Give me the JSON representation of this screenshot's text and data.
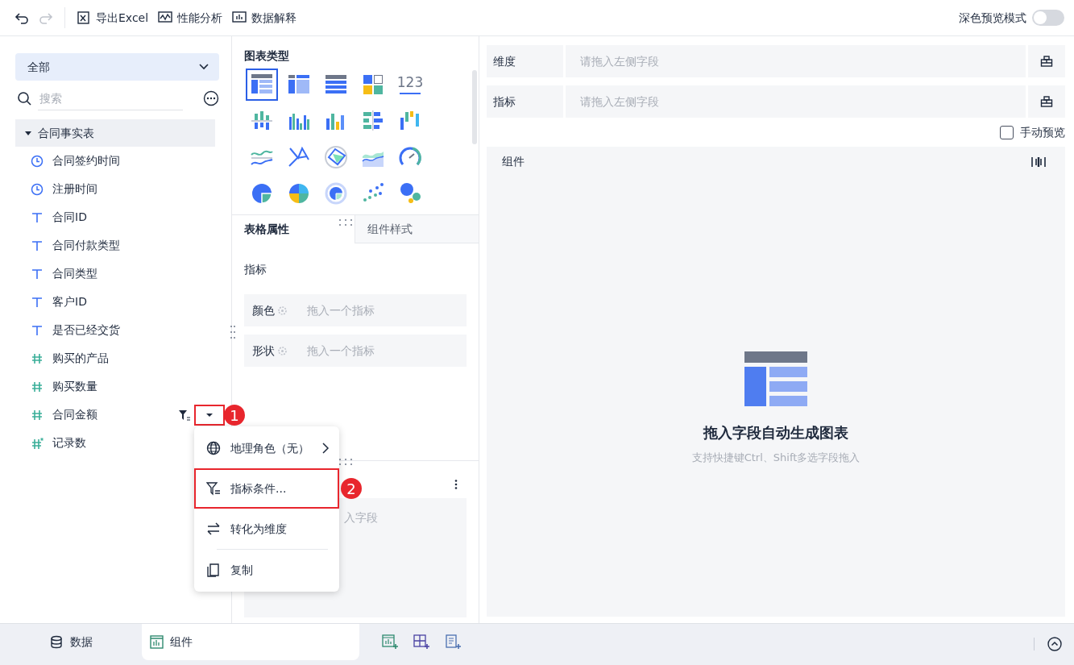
{
  "toolbar": {
    "buttons": [
      {
        "kind": "undo",
        "disabled": false
      },
      {
        "kind": "redo",
        "disabled": true
      },
      {
        "kind": "excel",
        "label": "导出Excel"
      },
      {
        "kind": "perf",
        "label": "性能分析"
      },
      {
        "kind": "explain",
        "label": "数据解释"
      }
    ],
    "dark_preview": {
      "label": "深色预览模式",
      "on": false
    }
  },
  "fields_panel": {
    "scope": "全部",
    "search_placeholder": "搜索",
    "tree": [
      {
        "label": "合同事实表",
        "expanded": true,
        "children": [
          {
            "kind": "date",
            "label": "合同签约时间"
          },
          {
            "kind": "date",
            "label": "注册时间"
          },
          {
            "kind": "text",
            "label": "合同ID"
          },
          {
            "kind": "text",
            "label": "合同付款类型"
          },
          {
            "kind": "text",
            "label": "合同类型"
          },
          {
            "kind": "text",
            "label": "客户ID"
          },
          {
            "kind": "text",
            "label": "是否已经交货"
          },
          {
            "kind": "number",
            "label": "购买的产品"
          },
          {
            "kind": "number",
            "label": "购买数量"
          },
          {
            "kind": "number",
            "label": "合同金额",
            "filtered": true,
            "menu_open": true
          },
          {
            "kind": "count",
            "label": "记录数"
          }
        ]
      }
    ]
  },
  "chart_types": {
    "title": "图表类型",
    "items": [
      {
        "kind": "table",
        "selected": true
      },
      {
        "kind": "cross",
        "selected": false
      },
      {
        "kind": "detail",
        "selected": false
      },
      {
        "kind": "card",
        "selected": false
      },
      {
        "kind": "number",
        "label": "123",
        "selected": false
      },
      {
        "kind": "bar-pm",
        "selected": false
      },
      {
        "kind": "bar-group",
        "selected": false
      },
      {
        "kind": "bar",
        "selected": false
      },
      {
        "kind": "bar-h",
        "selected": false
      },
      {
        "kind": "range",
        "selected": false
      },
      {
        "kind": "line",
        "selected": false
      },
      {
        "kind": "cross-line",
        "selected": false
      },
      {
        "kind": "radar",
        "selected": false
      },
      {
        "kind": "area",
        "selected": false
      },
      {
        "kind": "gauge",
        "selected": false
      },
      {
        "kind": "pie",
        "selected": false
      },
      {
        "kind": "pie-multi",
        "selected": false
      },
      {
        "kind": "donut",
        "selected": false
      },
      {
        "kind": "scatter",
        "selected": false
      },
      {
        "kind": "bubble",
        "selected": false
      }
    ]
  },
  "property_tabs": [
    {
      "label": "表格属性",
      "selected": true
    },
    {
      "label": "组件样式",
      "selected": false
    }
  ],
  "properties": {
    "section": "指标",
    "rows": [
      {
        "label": "颜色",
        "placeholder": "拖入一个指标"
      },
      {
        "label": "形状",
        "placeholder": "拖入一个指标"
      }
    ],
    "lower_field": "入字段"
  },
  "context_menu": {
    "items": [
      {
        "kind": "globe",
        "label": "地理角色（无）",
        "submenu": true,
        "highlighted": false
      },
      {
        "kind": "filter",
        "label": "指标条件...",
        "submenu": false,
        "highlighted": true
      },
      {
        "kind": "swap",
        "label": "转化为维度",
        "submenu": false,
        "highlighted": false
      },
      {
        "kind": "copy",
        "label": "复制",
        "submenu": false,
        "highlighted": false
      }
    ],
    "callouts": [
      "1",
      "2"
    ]
  },
  "axes": [
    {
      "label": "维度",
      "placeholder": "请拖入左侧字段"
    },
    {
      "label": "指标",
      "placeholder": "请拖入左侧字段"
    }
  ],
  "manual_preview": {
    "label": "手动预览",
    "checked": false
  },
  "component": {
    "title": "组件",
    "empty_title": "拖入字段自动生成图表",
    "empty_hint": "支持快捷键Ctrl、Shift多选字段拖入"
  },
  "bottom_tabs": [
    {
      "kind": "data",
      "label": "数据",
      "selected": false
    },
    {
      "kind": "component",
      "label": "组件",
      "selected": true
    }
  ],
  "bottom_actions": [
    {
      "kind": "add-chart"
    },
    {
      "kind": "add-dashboard"
    },
    {
      "kind": "add-report"
    }
  ]
}
